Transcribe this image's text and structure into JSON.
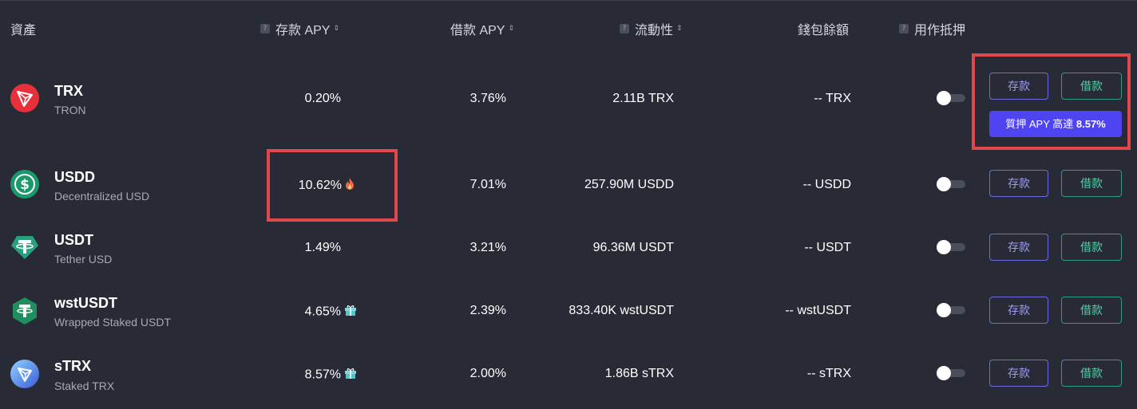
{
  "headers": {
    "asset": "資產",
    "supply_apy": "存款 APY",
    "borrow_apy": "借款 APY",
    "liquidity": "流動性",
    "wallet_balance": "錢包餘額",
    "collateral": "用作抵押",
    "help_mark": "?",
    "sort_glyph": "⇕"
  },
  "rows": [
    {
      "symbol": "TRX",
      "name": "TRON",
      "supply_apy": "0.20%",
      "borrow_apy": "3.76%",
      "liquidity": "2.11B TRX",
      "wallet": "-- TRX",
      "collateral_on": false,
      "deposit_label": "存款",
      "borrow_label": "借款",
      "icon": "tron-icon",
      "icon_color": "#e8303d"
    },
    {
      "symbol": "USDD",
      "name": "Decentralized USD",
      "supply_apy": "10.62%",
      "supply_badge": "fire-icon",
      "borrow_apy": "7.01%",
      "liquidity": "257.90M USDD",
      "wallet": "-- USDD",
      "collateral_on": false,
      "deposit_label": "存款",
      "borrow_label": "借款",
      "icon": "usdd-icon",
      "icon_color": "#1a9a6c"
    },
    {
      "symbol": "USDT",
      "name": "Tether USD",
      "supply_apy": "1.49%",
      "borrow_apy": "3.21%",
      "liquidity": "96.36M USDT",
      "wallet": "-- USDT",
      "collateral_on": false,
      "deposit_label": "存款",
      "borrow_label": "借款",
      "icon": "tether-icon",
      "icon_color": "#26a17b"
    },
    {
      "symbol": "wstUSDT",
      "name": "Wrapped Staked USDT",
      "supply_apy": "4.65%",
      "supply_badge": "gift-icon",
      "borrow_apy": "2.39%",
      "liquidity": "833.40K wstUSDT",
      "wallet": "-- wstUSDT",
      "collateral_on": false,
      "deposit_label": "存款",
      "borrow_label": "借款",
      "icon": "wst-usdt-icon",
      "icon_color": "#1f8f5f"
    },
    {
      "symbol": "sTRX",
      "name": "Staked TRX",
      "supply_apy": "8.57%",
      "supply_badge": "gift-icon",
      "borrow_apy": "2.00%",
      "liquidity": "1.86B sTRX",
      "wallet": "-- sTRX",
      "collateral_on": false,
      "deposit_label": "存款",
      "borrow_label": "借款",
      "icon": "strx-icon",
      "icon_color": "#4a7cf0"
    }
  ],
  "promo": {
    "prefix": "質押 APY 高達 ",
    "value": "8.57%"
  },
  "colors": {
    "background": "#282a35",
    "deposit_accent": "#6e6be0",
    "borrow_accent": "#2f9e82",
    "promo_bg": "#4e44f2",
    "highlight": "#e0484e"
  }
}
